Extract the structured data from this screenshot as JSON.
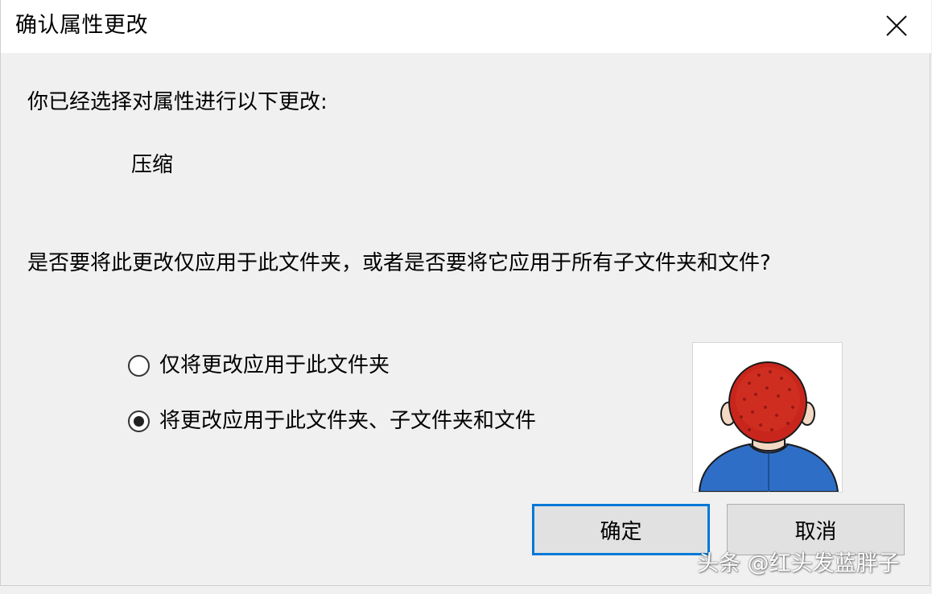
{
  "dialog": {
    "title": "确认属性更改",
    "intro_text": "你已经选择对属性进行以下更改:",
    "change_item": "压缩",
    "question_text": "是否要将此更改仅应用于此文件夹，或者是否要将它应用于所有子文件夹和文件?",
    "options": [
      {
        "label": "仅将更改应用于此文件夹",
        "selected": false
      },
      {
        "label": "将更改应用于此文件夹、子文件夹和文件",
        "selected": true
      }
    ],
    "ok_label": "确定",
    "cancel_label": "取消"
  },
  "icons": {
    "close": "close-icon",
    "avatar": "red-haired-person-illustration"
  },
  "colors": {
    "accent": "#0078d7",
    "title_bar": "#ffffff",
    "body": "#f0f0f0"
  },
  "watermark": "头条 @红头发蓝胖子"
}
